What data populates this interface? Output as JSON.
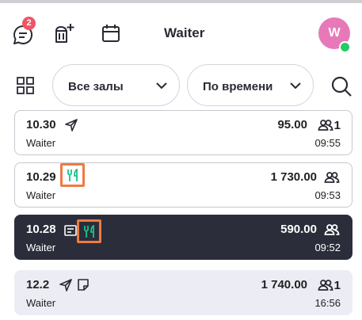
{
  "header": {
    "title": "Waiter",
    "chat_badge": "2",
    "avatar_initial": "W"
  },
  "filters": {
    "hall_select": "Все залы",
    "sort_select": "По времени"
  },
  "orders": [
    {
      "number": "10.30",
      "amount": "95.00",
      "guests": "1",
      "waiter": "Waiter",
      "time": "09:55"
    },
    {
      "number": "10.29",
      "amount": "1 730.00",
      "guests": "",
      "waiter": "Waiter",
      "time": "09:53"
    },
    {
      "number": "10.28",
      "amount": "590.00",
      "guests": "",
      "waiter": "Waiter",
      "time": "09:52"
    },
    {
      "number": "12.2",
      "amount": "1 740.00",
      "guests": "1",
      "waiter": "Waiter",
      "time": "16:56"
    }
  ],
  "colors": {
    "badge": "#ee5566",
    "avatar": "#e879b8",
    "online": "#22cc66",
    "selected_card": "#2b2d3a",
    "highlight": "#f07a42",
    "dish_icon": "#19c38a"
  }
}
